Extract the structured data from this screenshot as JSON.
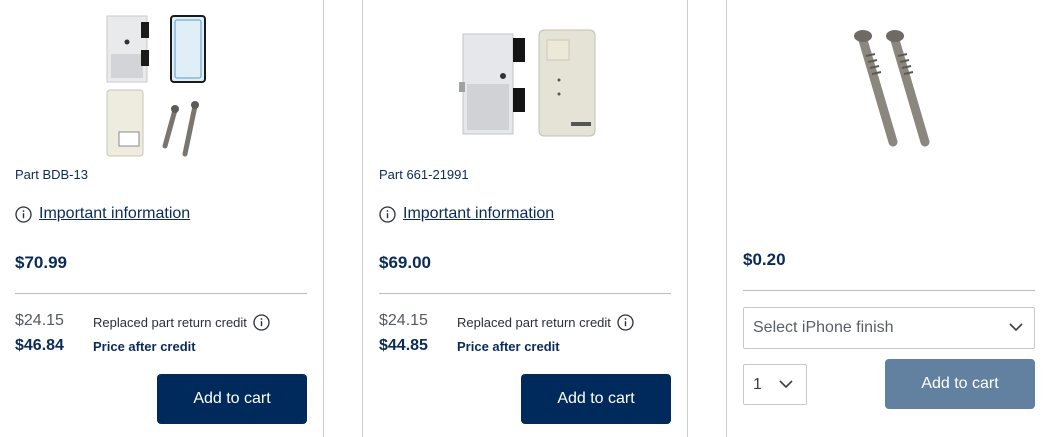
{
  "products": [
    {
      "part_number": "Part BDB-13",
      "info_link": "Important information",
      "price": "$70.99",
      "credit_amount": "$24.15",
      "credit_label": "Replaced part return credit",
      "after_credit_amount": "$46.84",
      "after_credit_label": "Price after credit",
      "add_to_cart": "Add to cart",
      "image_icon": "battery-repair-kit-image"
    },
    {
      "part_number": "Part 661-21991",
      "info_link": "Important information",
      "price": "$69.00",
      "credit_amount": "$24.15",
      "credit_label": "Replaced part return credit",
      "after_credit_amount": "$44.85",
      "after_credit_label": "Price after credit",
      "add_to_cart": "Add to cart",
      "image_icon": "battery-image"
    },
    {
      "price": "$0.20",
      "finish_select": "Select iPhone finish",
      "quantity": "1",
      "add_to_cart": "Add to cart",
      "image_icon": "screws-image"
    }
  ],
  "colors": {
    "primary_button": "#002a5c",
    "disabled_button": "#62809f",
    "text_primary": "#0a2a5a"
  }
}
